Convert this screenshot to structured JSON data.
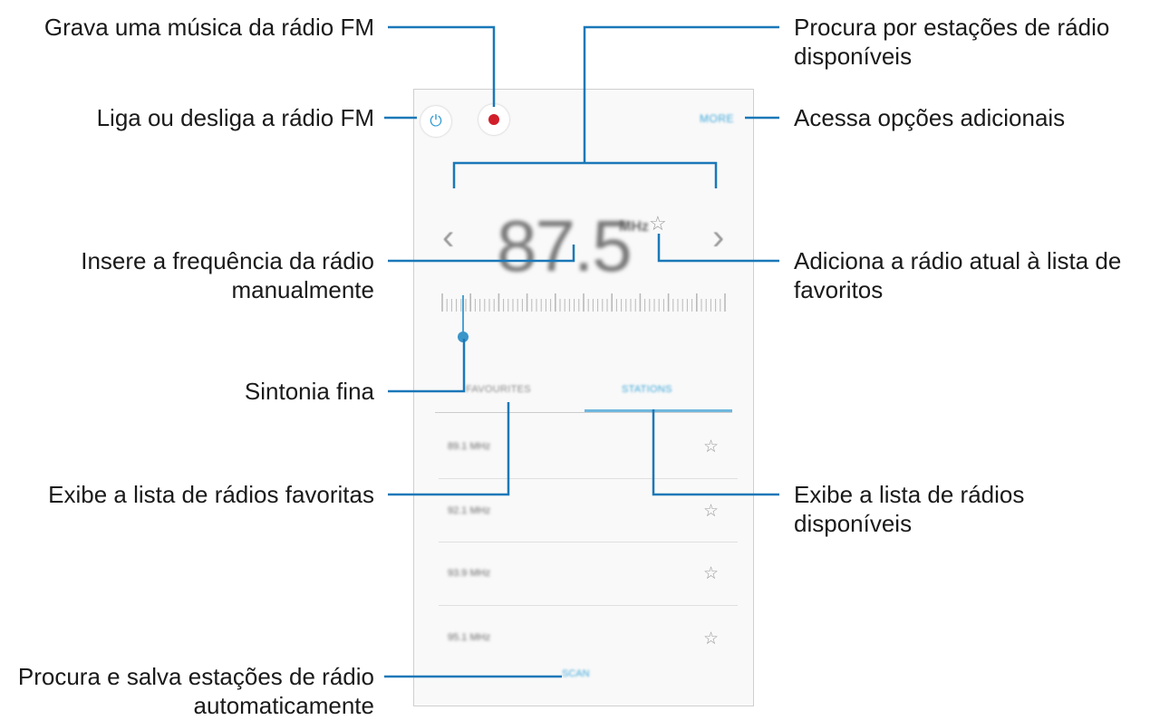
{
  "labels": {
    "record": "Grava uma música da rádio FM",
    "power": "Liga ou desliga a rádio FM",
    "manual_freq_l1": "Insere a frequência da rádio",
    "manual_freq_l2": "manualmente",
    "fine_tune": "Sintonia fina",
    "favorites_list": "Exibe a lista de rádios favoritas",
    "autoscan_l1": "Procura e salva estações de rádio",
    "autoscan_l2": "automaticamente",
    "search_l1": "Procura por estações de rádio",
    "search_l2": "disponíveis",
    "more_options": "Acessa opções adicionais",
    "add_fav_l1": "Adiciona a rádio atual à lista de",
    "add_fav_l2": "favoritos",
    "stations_list_l1": "Exibe a lista de rádios",
    "stations_list_l2": "disponíveis"
  },
  "radio": {
    "more_label": "MORE",
    "frequency": "87.5",
    "unit": "MHz",
    "tab_favorites": "FAVOURITES",
    "tab_stations": "STATIONS",
    "scan_label": "SCAN",
    "stations": [
      {
        "freq": "89.1 MHz"
      },
      {
        "freq": "92.1 MHz"
      },
      {
        "freq": "93.9 MHz"
      },
      {
        "freq": "95.1 MHz"
      }
    ]
  },
  "colors": {
    "accent": "#1a78b8",
    "record": "#d11f2a"
  },
  "icons": {
    "power": "power-icon",
    "record": "record-icon",
    "prev": "chevron-left-icon",
    "next": "chevron-right-icon",
    "favorite": "star-icon"
  }
}
